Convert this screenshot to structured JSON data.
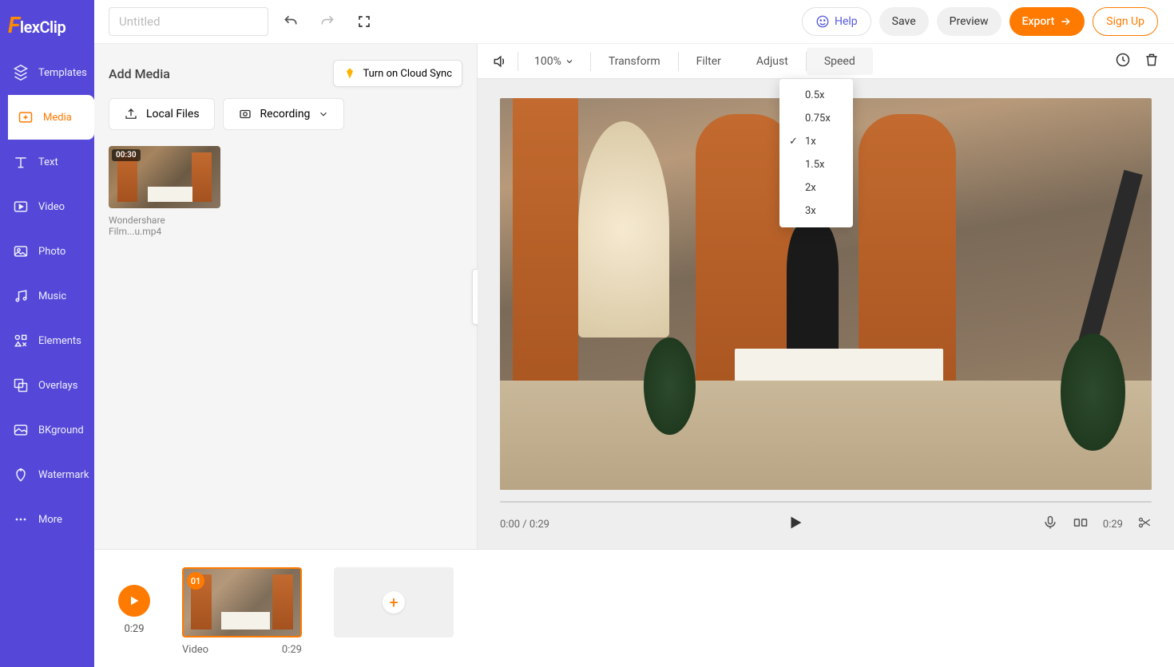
{
  "brand": {
    "f": "F",
    "name": "lexClip"
  },
  "sidebar": {
    "items": [
      {
        "label": "Templates"
      },
      {
        "label": "Media"
      },
      {
        "label": "Text"
      },
      {
        "label": "Video"
      },
      {
        "label": "Photo"
      },
      {
        "label": "Music"
      },
      {
        "label": "Elements"
      },
      {
        "label": "Overlays"
      },
      {
        "label": "BKground"
      },
      {
        "label": "Watermark"
      },
      {
        "label": "More"
      }
    ]
  },
  "topbar": {
    "title_placeholder": "Untitled",
    "help": "Help",
    "save": "Save",
    "preview": "Preview",
    "export": "Export",
    "signup": "Sign Up"
  },
  "media_panel": {
    "title": "Add Media",
    "cloud_sync": "Turn on Cloud Sync",
    "local_files": "Local Files",
    "recording": "Recording",
    "clip": {
      "duration": "00:30",
      "filename": "Wondershare Film...u.mp4"
    }
  },
  "editor_toolbar": {
    "zoom": "100%",
    "transform": "Transform",
    "filter": "Filter",
    "adjust": "Adjust",
    "speed": "Speed"
  },
  "speed_menu": {
    "options": [
      {
        "label": "0.5x",
        "selected": false
      },
      {
        "label": "0.75x",
        "selected": false
      },
      {
        "label": "1x",
        "selected": true
      },
      {
        "label": "1.5x",
        "selected": false
      },
      {
        "label": "2x",
        "selected": false
      },
      {
        "label": "3x",
        "selected": false
      }
    ]
  },
  "preview": {
    "time_current": "0:00",
    "time_sep": " / ",
    "time_total": "0:29",
    "right_time": "0:29"
  },
  "timeline": {
    "play_time": "0:29",
    "clip1": {
      "badge": "01",
      "type": "Video",
      "duration": "0:29"
    }
  },
  "colors": {
    "accent": "#ff7a00",
    "primary": "#5548d8"
  }
}
